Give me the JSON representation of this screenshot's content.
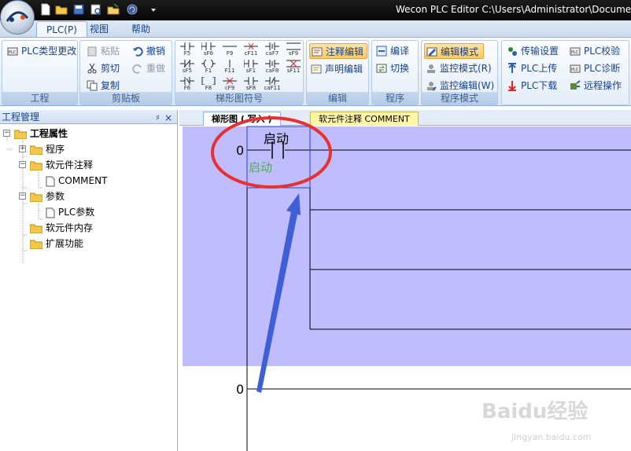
{
  "window": {
    "title": "Wecon PLC Editor  C:\\Users\\Administrator\\Docume"
  },
  "app_logo": "PLC",
  "tabs": [
    {
      "label": "PLC(P)"
    },
    {
      "label": "视图"
    },
    {
      "label": "帮助"
    }
  ],
  "ribbon": {
    "groups": [
      {
        "label": "工程",
        "buttons": [
          {
            "label": "PLC类型更改"
          }
        ]
      },
      {
        "label": "剪贴板",
        "buttons": [
          {
            "label": "粘贴"
          },
          {
            "label": "剪切"
          },
          {
            "label": "复制"
          },
          {
            "label": "撤销"
          },
          {
            "label": "重做"
          }
        ]
      },
      {
        "label": "梯形图符号",
        "symbols": [
          "F5",
          "sF6",
          "F9",
          "cF11",
          "caF7",
          "sF9",
          "sF5",
          "F1",
          "F11",
          "sF1",
          "caF8",
          "sF11",
          "F6",
          "F8",
          "cF9",
          "sF8",
          "caF11"
        ]
      },
      {
        "label": "编辑",
        "buttons": [
          {
            "label": "注释编辑"
          },
          {
            "label": "声明编辑"
          }
        ]
      },
      {
        "label": "程序",
        "buttons": [
          {
            "label": "编译"
          },
          {
            "label": "切换"
          }
        ]
      },
      {
        "label": "程序模式",
        "buttons": [
          {
            "label": "编辑模式"
          },
          {
            "label": "监控模式(R)"
          },
          {
            "label": "监控编辑(W)"
          }
        ]
      },
      {
        "label": "",
        "buttons": [
          {
            "label": "传输设置"
          },
          {
            "label": "PLC上传"
          },
          {
            "label": "PLC下载"
          },
          {
            "label": "PLC校验"
          },
          {
            "label": "PLC诊断"
          },
          {
            "label": "远程操作"
          }
        ]
      }
    ]
  },
  "left_panel": {
    "title": "工程管理",
    "pin": "♯",
    "close": "×",
    "tree": [
      {
        "label": "工程属性"
      },
      {
        "label": "程序"
      },
      {
        "label": "软元件注释"
      },
      {
        "label": "COMMENT"
      },
      {
        "label": "参数"
      },
      {
        "label": "PLC参数"
      },
      {
        "label": "软元件内存"
      },
      {
        "label": "扩展功能"
      }
    ]
  },
  "editor": {
    "tabs": [
      {
        "label": "梯形图 ( 写入 )"
      },
      {
        "label": "软元件注释 COMMENT"
      }
    ],
    "rungs": [
      {
        "step": "0",
        "contact_comment": "启动",
        "contact_device": "启动"
      },
      {
        "step": "0"
      }
    ]
  },
  "colors": {
    "ladder_selection_bg": "#bfbdfd",
    "annotation_circle": "#e8302e",
    "annotation_arrow": "#3f5fd6",
    "ribbon_selected": "#fbc863"
  },
  "watermark": {
    "logo": "Baidu经验",
    "url": "jingyan.baidu.com"
  }
}
